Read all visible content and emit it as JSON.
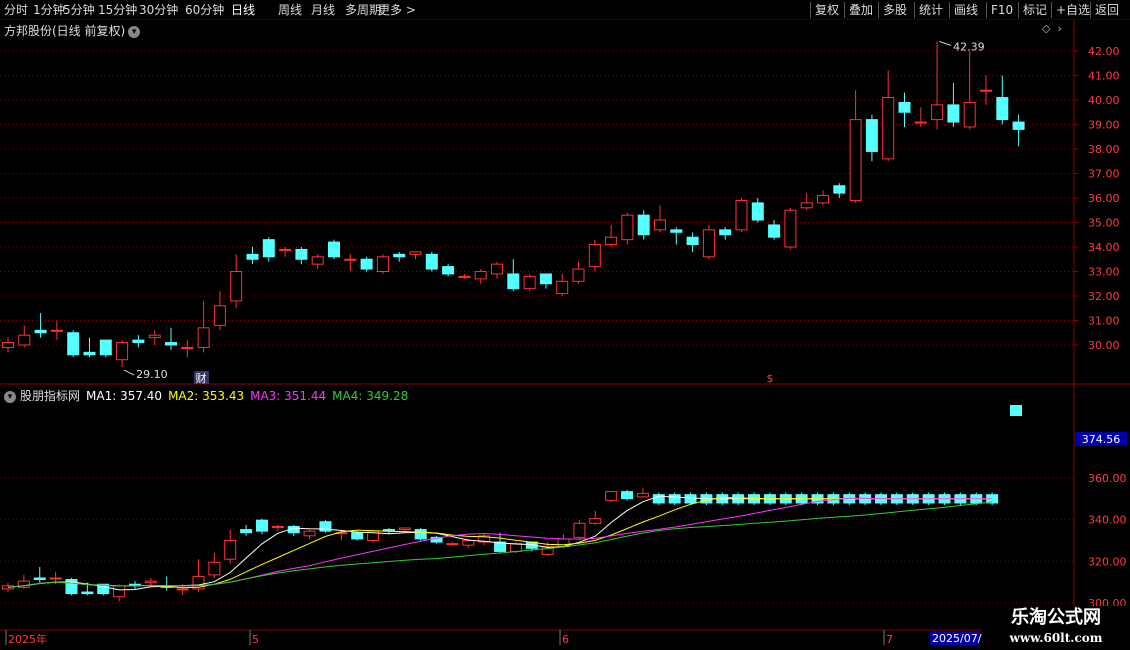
{
  "toolbar": {
    "left_items": [
      "分时",
      "1分钟",
      "5分钟",
      "15分钟",
      "30分钟",
      "60分钟",
      "日线",
      "周线",
      "月线",
      "多周期",
      "更多 >"
    ],
    "active_item": "日线",
    "right_items": [
      "复权",
      "叠加",
      "多股",
      "统计",
      "画线",
      "F10",
      "标记",
      "+自选",
      "返回"
    ]
  },
  "stock": {
    "title": "方邦股份(日线 前复权)",
    "high_label": "42.39",
    "low_label": "29.10",
    "event_marker_cai": "财",
    "event_marker_dollar": "$",
    "price_axis_labels": [
      "42.00",
      "41.00",
      "40.00",
      "39.00",
      "38.00",
      "37.00",
      "36.00",
      "35.00",
      "34.00",
      "33.00",
      "32.00",
      "31.00",
      "30.00"
    ],
    "corner_icon": "diamond-icon",
    "corner_arrow": "chevron-right-icon"
  },
  "indicator": {
    "name": "股朋指标网",
    "ma1_label": "MA1: 357.40",
    "ma2_label": "MA2: 353.43",
    "ma3_label": "MA3: 351.44",
    "ma4_label": "MA4: 349.28",
    "colors": {
      "ma1": "#ffffff",
      "ma2": "#ffff00",
      "ma3": "#ff33ff",
      "ma4": "#33cc33"
    },
    "axis_labels": [
      "360.00",
      "340.00",
      "320.00",
      "300.00"
    ],
    "current_value": "374.56"
  },
  "time_axis": {
    "labels": [
      "2025年",
      "5",
      "6",
      "7"
    ],
    "cursor_date": "2025/07/"
  },
  "watermark": {
    "line1": "乐淘公式网",
    "line2": "www.60lt.com"
  },
  "colors": {
    "up": "#ff3232",
    "down": "#54ffff",
    "grid": "#8b0000",
    "axis": "#8b0000",
    "bg": "#000000"
  },
  "chart_data": {
    "type": "candlestick",
    "candles": [
      [
        29.9,
        30.1,
        29.7,
        30.3
      ],
      [
        30.0,
        30.4,
        29.9,
        30.8
      ],
      [
        30.6,
        30.5,
        30.3,
        31.3
      ],
      [
        30.6,
        30.6,
        30.2,
        31.0
      ],
      [
        30.5,
        29.6,
        29.5,
        30.6
      ],
      [
        29.7,
        29.6,
        29.5,
        30.3
      ],
      [
        30.2,
        29.6,
        29.5,
        30.2
      ],
      [
        29.4,
        30.1,
        29.1,
        30.2
      ],
      [
        30.2,
        30.1,
        29.9,
        30.4
      ],
      [
        30.3,
        30.4,
        30.0,
        30.6
      ],
      [
        30.1,
        30.0,
        29.8,
        30.7
      ],
      [
        29.9,
        29.9,
        29.5,
        30.2
      ],
      [
        29.9,
        30.7,
        29.7,
        31.8
      ],
      [
        30.8,
        31.6,
        30.6,
        32.2
      ],
      [
        31.8,
        33.0,
        31.5,
        33.7
      ],
      [
        33.7,
        33.5,
        33.3,
        34.0
      ],
      [
        34.3,
        33.6,
        33.4,
        34.4
      ],
      [
        33.9,
        33.9,
        33.6,
        34.0
      ],
      [
        33.9,
        33.5,
        33.3,
        34.0
      ],
      [
        33.3,
        33.6,
        33.1,
        33.7
      ],
      [
        34.2,
        33.6,
        33.5,
        34.3
      ],
      [
        33.5,
        33.5,
        33.0,
        33.7
      ],
      [
        33.5,
        33.1,
        33.0,
        33.6
      ],
      [
        33.0,
        33.6,
        32.9,
        33.7
      ],
      [
        33.7,
        33.6,
        33.4,
        33.8
      ],
      [
        33.7,
        33.8,
        33.5,
        33.8
      ],
      [
        33.7,
        33.1,
        33.0,
        33.8
      ],
      [
        33.2,
        32.9,
        32.8,
        33.3
      ],
      [
        32.8,
        32.8,
        32.7,
        32.9
      ],
      [
        32.7,
        33.0,
        32.5,
        33.1
      ],
      [
        32.9,
        33.3,
        32.7,
        33.4
      ],
      [
        32.9,
        32.3,
        32.2,
        33.5
      ],
      [
        32.3,
        32.8,
        32.2,
        32.9
      ],
      [
        32.9,
        32.5,
        32.3,
        32.9
      ],
      [
        32.1,
        32.6,
        32.0,
        32.9
      ],
      [
        32.6,
        33.1,
        32.5,
        33.4
      ],
      [
        33.2,
        34.1,
        33.0,
        34.3
      ],
      [
        34.1,
        34.4,
        34.0,
        34.9
      ],
      [
        34.3,
        35.3,
        34.1,
        35.4
      ],
      [
        35.3,
        34.5,
        34.3,
        35.5
      ],
      [
        34.7,
        35.1,
        34.6,
        35.7
      ],
      [
        34.7,
        34.6,
        34.1,
        34.8
      ],
      [
        34.4,
        34.1,
        33.8,
        34.6
      ],
      [
        33.6,
        34.7,
        33.5,
        34.9
      ],
      [
        34.7,
        34.5,
        34.3,
        34.8
      ],
      [
        34.7,
        35.9,
        34.6,
        36.0
      ],
      [
        35.8,
        35.1,
        35.0,
        36.0
      ],
      [
        34.9,
        34.4,
        34.3,
        35.1
      ],
      [
        34.0,
        35.5,
        33.9,
        35.6
      ],
      [
        35.6,
        35.8,
        35.5,
        36.2
      ],
      [
        35.8,
        36.1,
        35.7,
        36.3
      ],
      [
        36.5,
        36.2,
        36.0,
        36.6
      ],
      [
        35.9,
        39.2,
        35.8,
        40.4
      ],
      [
        39.2,
        37.9,
        37.5,
        39.4
      ],
      [
        37.6,
        40.1,
        37.5,
        41.2
      ],
      [
        39.9,
        39.5,
        38.9,
        40.3
      ],
      [
        39.1,
        39.1,
        38.9,
        39.7
      ],
      [
        39.2,
        39.8,
        38.8,
        42.39
      ],
      [
        39.8,
        39.1,
        38.9,
        40.7
      ],
      [
        38.9,
        39.9,
        38.8,
        42.0
      ],
      [
        40.4,
        40.4,
        39.8,
        41.0
      ],
      [
        40.1,
        39.2,
        39.0,
        41.0
      ],
      [
        39.1,
        38.8,
        38.1,
        39.4
      ]
    ]
  }
}
